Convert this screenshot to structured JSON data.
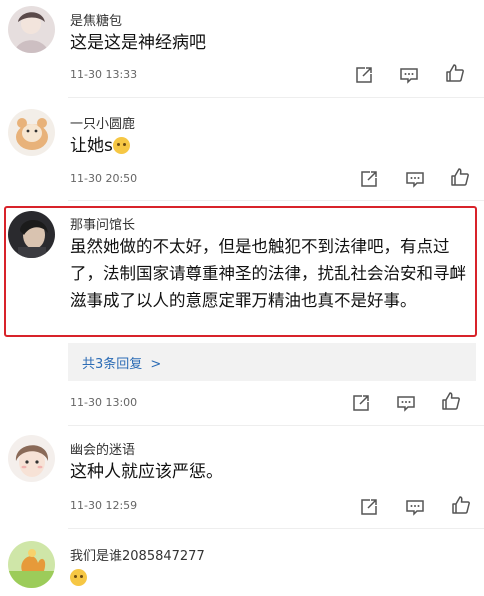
{
  "comments": [
    {
      "username": "是焦糖包",
      "text": "这是这是神经病吧",
      "time": "11-30 13:33"
    },
    {
      "username": "一只小圆鹿",
      "text": "让她s",
      "emoji": "emoji-grimace",
      "time": "11-30 20:50"
    },
    {
      "username": "那事问馆长",
      "text": "虽然她做的不太好，但是也触犯不到法律吧，有点过了，法制国家请尊重神圣的法律，扰乱社会治安和寻衅滋事成了以人的意愿定罪万精油也真不是好事。",
      "time": "11-30 13:00",
      "replies_label": "共3条回复",
      "replies_chevron": ">"
    },
    {
      "username": "幽会的迷语",
      "text": "这种人就应该严惩。",
      "time": "11-30 12:59"
    },
    {
      "username": "我们是谁2085847277",
      "emoji": "emoji-grimace"
    }
  ],
  "icons": {
    "share": "share-icon",
    "comment": "comment-icon",
    "like": "thumbs-up-icon"
  },
  "colors": {
    "highlight": "#d8232a",
    "link": "#2c6cb5"
  }
}
